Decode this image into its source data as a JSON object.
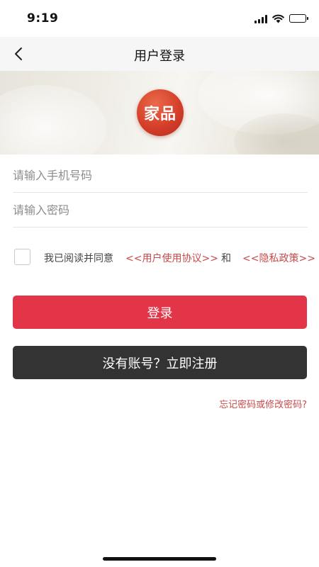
{
  "status_bar": {
    "time": "9:19",
    "icons": [
      "signal-icon",
      "wifi-icon",
      "battery-icon"
    ]
  },
  "nav": {
    "back_icon": "chevron-left-icon",
    "title": "用户登录"
  },
  "logo": {
    "text": "家品",
    "color": "#d53f2a"
  },
  "form": {
    "phone_placeholder": "请输入手机号码",
    "phone_value": "",
    "password_placeholder": "请输入密码",
    "password_value": ""
  },
  "agreement": {
    "checked": false,
    "prefix": "我已阅读并同意",
    "terms_link": "<<用户使用协议>>",
    "and_text": "和",
    "privacy_link": "<<隐私政策>>"
  },
  "buttons": {
    "login_label": "登录",
    "register_label": "没有账号？立即注册"
  },
  "forgot_link": "忘记密码或修改密码?",
  "colors": {
    "accent": "#e33548",
    "link": "#c94a4a",
    "dark_button": "#333333"
  }
}
